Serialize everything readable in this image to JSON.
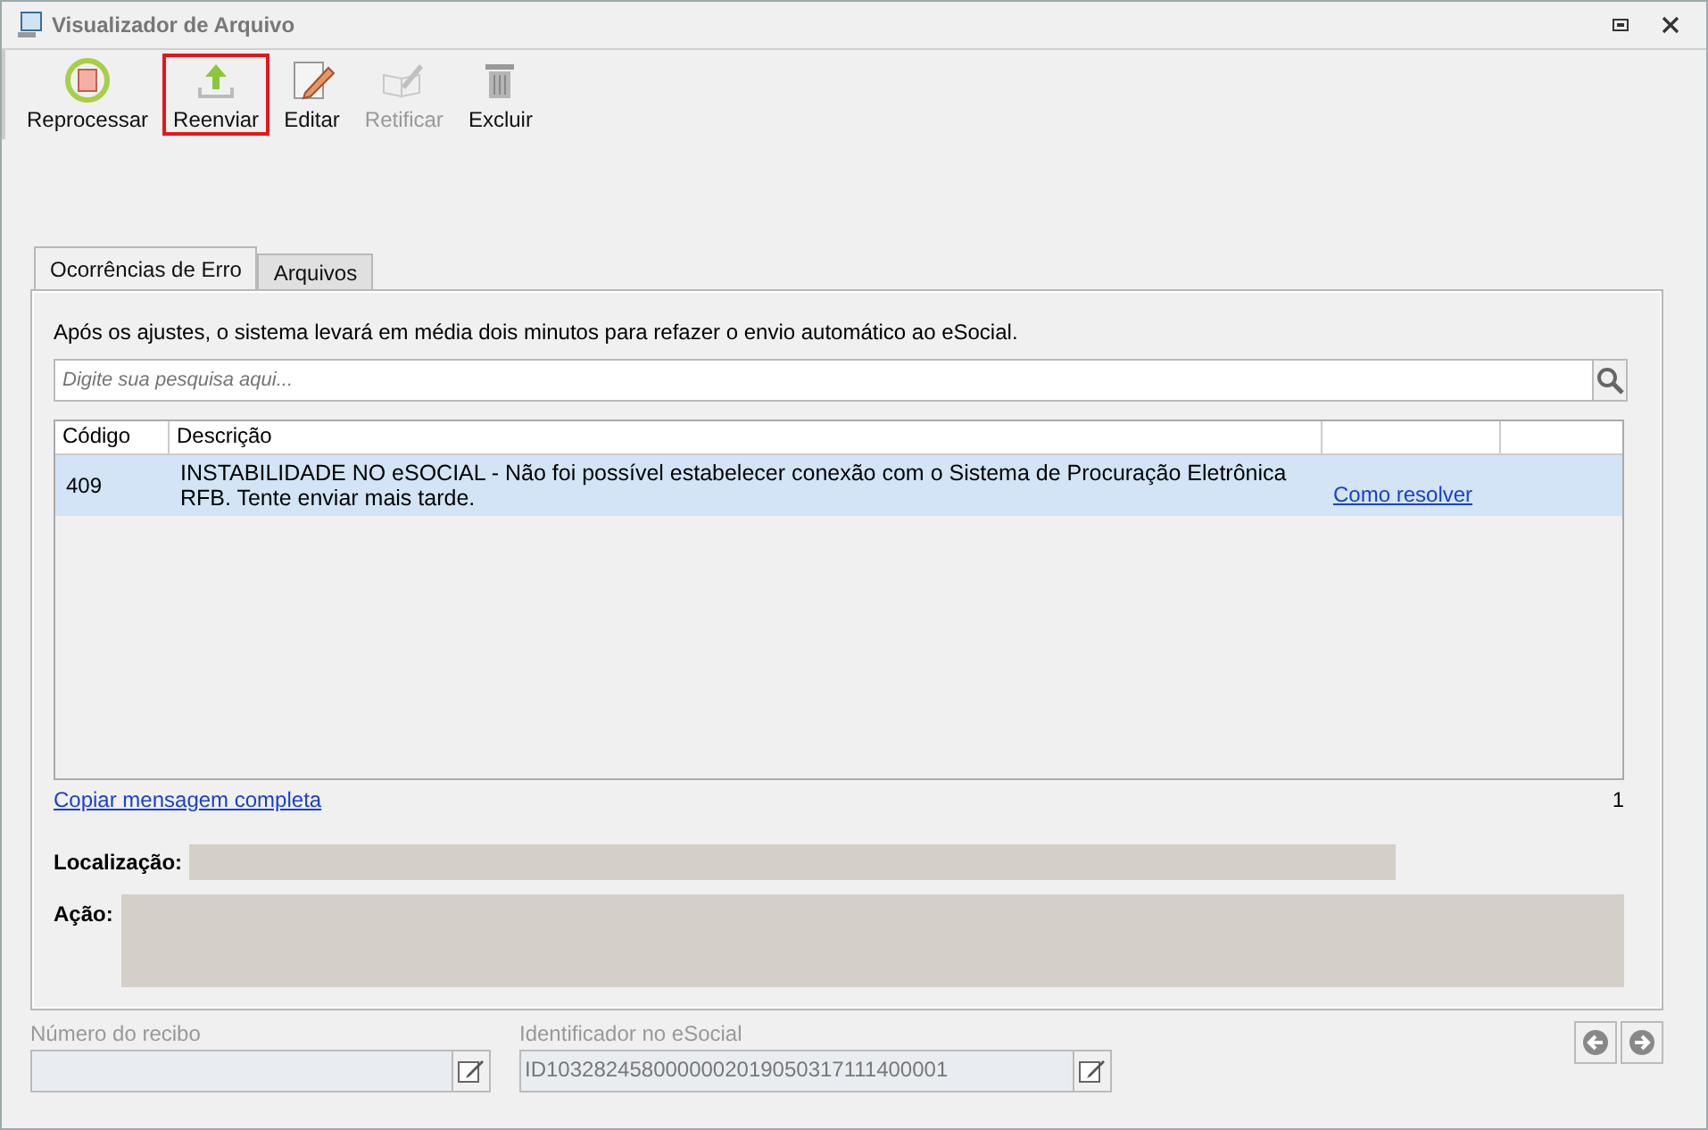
{
  "window": {
    "title": "Visualizador de Arquivo"
  },
  "toolbar": [
    {
      "label": "Reprocessar",
      "kind": "reprocess",
      "disabled": false,
      "highlighted": false
    },
    {
      "label": "Reenviar",
      "kind": "upload",
      "disabled": false,
      "highlighted": true
    },
    {
      "label": "Editar",
      "kind": "edit",
      "disabled": false,
      "highlighted": false
    },
    {
      "label": "Retificar",
      "kind": "rectify",
      "disabled": true,
      "highlighted": false
    },
    {
      "label": "Excluir",
      "kind": "delete",
      "disabled": false,
      "highlighted": false
    }
  ],
  "tabs": [
    {
      "label": "Ocorrências de Erro",
      "selected": true
    },
    {
      "label": "Arquivos",
      "selected": false
    }
  ],
  "notice": "Após os ajustes, o sistema levará em média dois minutos para refazer o envio automático ao eSocial.",
  "search": {
    "placeholder": "Digite sua pesquisa aqui..."
  },
  "table": {
    "columns": [
      "Código",
      "Descrição"
    ],
    "rows": [
      {
        "code": "409",
        "description": "INSTABILIDADE NO eSOCIAL - Não foi possível estabelecer conexão com o Sistema de Procuração Eletrônica RFB. Tente enviar mais tarde.",
        "link": "Como resolver",
        "selected": true
      }
    ]
  },
  "copy_link": "Copiar mensagem completa",
  "count": "1",
  "location": {
    "label": "Localização:"
  },
  "action": {
    "label": "Ação:"
  },
  "receipt": {
    "label": "Número do recibo"
  },
  "esocial_id": {
    "label": "Identificador no eSocial",
    "value": "ID1032824580000002019050317111400001"
  }
}
